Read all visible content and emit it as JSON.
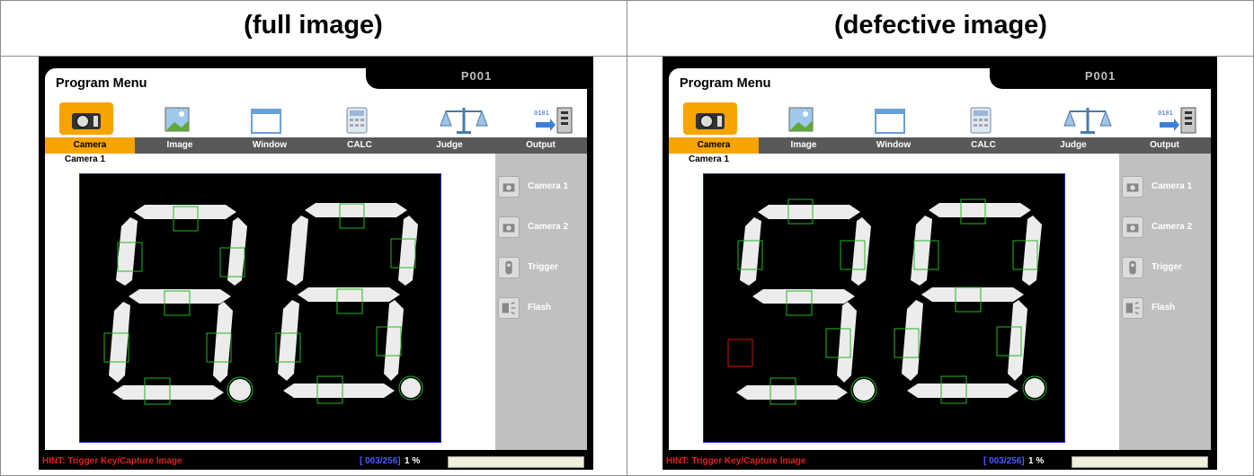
{
  "captions": {
    "full": "(full image)",
    "defective": "(defective image)"
  },
  "screen": {
    "title": "Program Menu",
    "program": "P001",
    "tabs": [
      "Camera",
      "Image",
      "Window",
      "CALC",
      "Judge",
      "Output"
    ],
    "active_tab": "Camera",
    "icons": [
      "camera-icon",
      "image-icon",
      "window-icon",
      "calculator-icon",
      "scale-icon",
      "output-icon"
    ],
    "camera_label": "Camera 1",
    "side_menu": [
      "Camera 1",
      "Camera 2",
      "Trigger",
      "Flash"
    ],
    "side_icons": [
      "camera-icon",
      "camera-icon",
      "trigger-icon",
      "flash-icon"
    ],
    "hint": "HINT: Trigger Key/Capture Image",
    "count": "[ 003/256]",
    "percent": "1 %",
    "progress": 0.0
  },
  "colors": {
    "accent": "#f7a400",
    "tab_bar": "#595959",
    "side": "#c0c0c0",
    "roi_ok": "#1fb81f",
    "roi_ng": "#d01010",
    "view_border": "#2030c8",
    "hint": "#e02020",
    "count": "#4a5cff"
  }
}
